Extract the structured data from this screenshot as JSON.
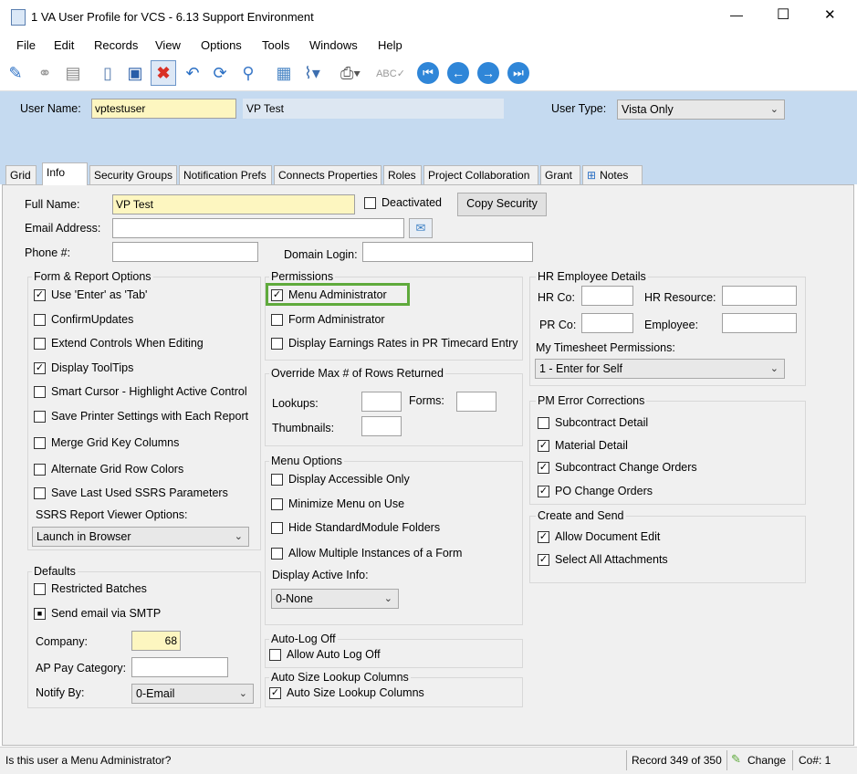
{
  "window": {
    "title": "1 VA User Profile for VCS - 6.13 Support Environment",
    "minimize": "—",
    "maximize": "☐",
    "close": "✕"
  },
  "menu": [
    "File",
    "Edit",
    "Records",
    "View",
    "Options",
    "Tools",
    "Windows",
    "Help"
  ],
  "toolbar": {
    "icons": [
      "edit-icon",
      "binoculars-icon",
      "print-icon",
      "new-record-icon",
      "save-icon",
      "delete-icon",
      "undo-icon",
      "refresh-icon",
      "search-icon",
      "calculator-icon",
      "attachment-icon",
      "scan-icon",
      "spellcheck-icon",
      "first-record-icon",
      "previous-record-icon",
      "next-record-icon",
      "last-record-icon"
    ]
  },
  "header": {
    "user_name_label": "User Name:",
    "user_name_value": "vptestuser",
    "display_name": "VP Test",
    "user_type_label": "User Type:",
    "user_type_value": "Vista Only"
  },
  "tabs": [
    "Grid",
    "Info",
    "Security Groups",
    "Notification Prefs",
    "Connects Properties",
    "Roles",
    "Project Collaboration",
    "Grant",
    "Notes"
  ],
  "info": {
    "full_name_label": "Full Name:",
    "full_name_value": "VP Test",
    "deactivated_label": "Deactivated",
    "copy_security_label": "Copy Security",
    "email_label": "Email Address:",
    "email_value": "",
    "phone_label": "Phone #:",
    "phone_value": "",
    "domain_login_label": "Domain Login:",
    "domain_login_value": "",
    "form_report": {
      "title": "Form & Report Options",
      "items": [
        {
          "label": "Use 'Enter' as 'Tab'",
          "checked": true
        },
        {
          "label": "ConfirmUpdates",
          "checked": false
        },
        {
          "label": "Extend Controls When Editing",
          "checked": false
        },
        {
          "label": "Display ToolTips",
          "checked": true
        },
        {
          "label": "Smart Cursor - Highlight Active Control",
          "checked": false
        },
        {
          "label": "Save Printer Settings with Each Report",
          "checked": false
        },
        {
          "label": "Merge Grid Key Columns",
          "checked": false
        },
        {
          "label": "Alternate Grid Row Colors",
          "checked": false
        },
        {
          "label": "Save Last Used SSRS Parameters",
          "checked": false
        }
      ],
      "ssrs_label": "SSRS Report Viewer Options:",
      "ssrs_value": "Launch in Browser"
    },
    "defaults": {
      "title": "Defaults",
      "restricted_label": "Restricted Batches",
      "smtp_label": "Send email via SMTP",
      "company_label": "Company:",
      "company_value": "68",
      "ap_pay_label": "AP Pay Category:",
      "ap_pay_value": "",
      "notify_label": "Notify By:",
      "notify_value": "0-Email"
    },
    "permissions": {
      "title": "Permissions",
      "items": [
        {
          "label": "Menu Administrator",
          "checked": true
        },
        {
          "label": "Form Administrator",
          "checked": false
        },
        {
          "label": "Display Earnings Rates in PR Timecard Entry",
          "checked": false
        }
      ]
    },
    "override": {
      "title": "Override Max # of Rows Returned",
      "lookups_label": "Lookups:",
      "forms_label": "Forms:",
      "thumbnails_label": "Thumbnails:"
    },
    "menu_options": {
      "title": "Menu Options",
      "items": [
        {
          "label": "Display Accessible Only",
          "checked": false
        },
        {
          "label": "Minimize Menu on Use",
          "checked": false
        },
        {
          "label": "Hide StandardModule Folders",
          "checked": false
        },
        {
          "label": "Allow Multiple Instances of a Form",
          "checked": false
        }
      ],
      "active_info_label": "Display Active Info:",
      "active_info_value": "0-None"
    },
    "auto_log": {
      "title": "Auto-Log Off",
      "item": "Allow Auto Log Off"
    },
    "auto_size": {
      "title": "Auto Size Lookup Columns",
      "item": "Auto Size Lookup Columns"
    },
    "hr": {
      "title": "HR  Employee Details",
      "hr_co_label": "HR Co:",
      "hr_resource_label": "HR Resource:",
      "pr_co_label": "PR Co:",
      "employee_label": "Employee:",
      "timesheet_label": "My Timesheet Permissions:",
      "timesheet_value": "1 - Enter for Self"
    },
    "pm": {
      "title": "PM Error Corrections",
      "items": [
        {
          "label": "Subcontract Detail",
          "checked": false
        },
        {
          "label": "Material Detail",
          "checked": true
        },
        {
          "label": "Subcontract Change Orders",
          "checked": true
        },
        {
          "label": "PO Change Orders",
          "checked": true
        }
      ]
    },
    "create_send": {
      "title": "Create and Send",
      "items": [
        {
          "label": "Allow Document Edit",
          "checked": true
        },
        {
          "label": "Select All Attachments",
          "checked": true
        }
      ]
    }
  },
  "status": {
    "message": "Is this user a Menu Administrator?",
    "record": "Record 349 of 350",
    "change": "Change",
    "co": "Co#: 1"
  },
  "colors": {
    "header_bg": "#c5daf0",
    "highlight": "#5faa3c",
    "yellow": "#fdf6c0"
  }
}
